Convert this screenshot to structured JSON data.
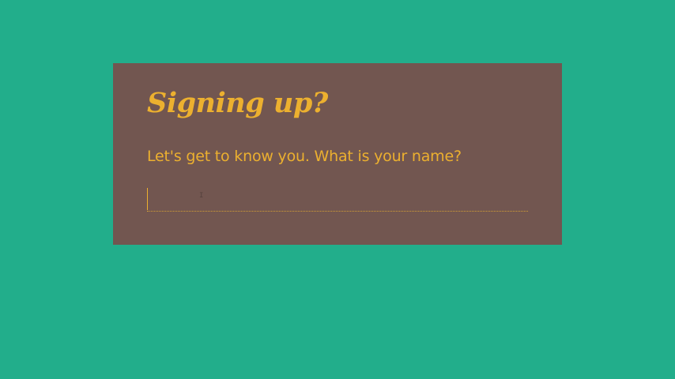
{
  "colors": {
    "background": "#22ae8b",
    "card": "#725650",
    "accent": "#ecb02f",
    "field_line": "#d4a035"
  },
  "card": {
    "title": "Signing up?",
    "prompt": "Let's get to know you. What is your name?",
    "name_input": {
      "value": "",
      "placeholder": ""
    }
  },
  "icons": {
    "pointer": "text-cursor-icon"
  }
}
